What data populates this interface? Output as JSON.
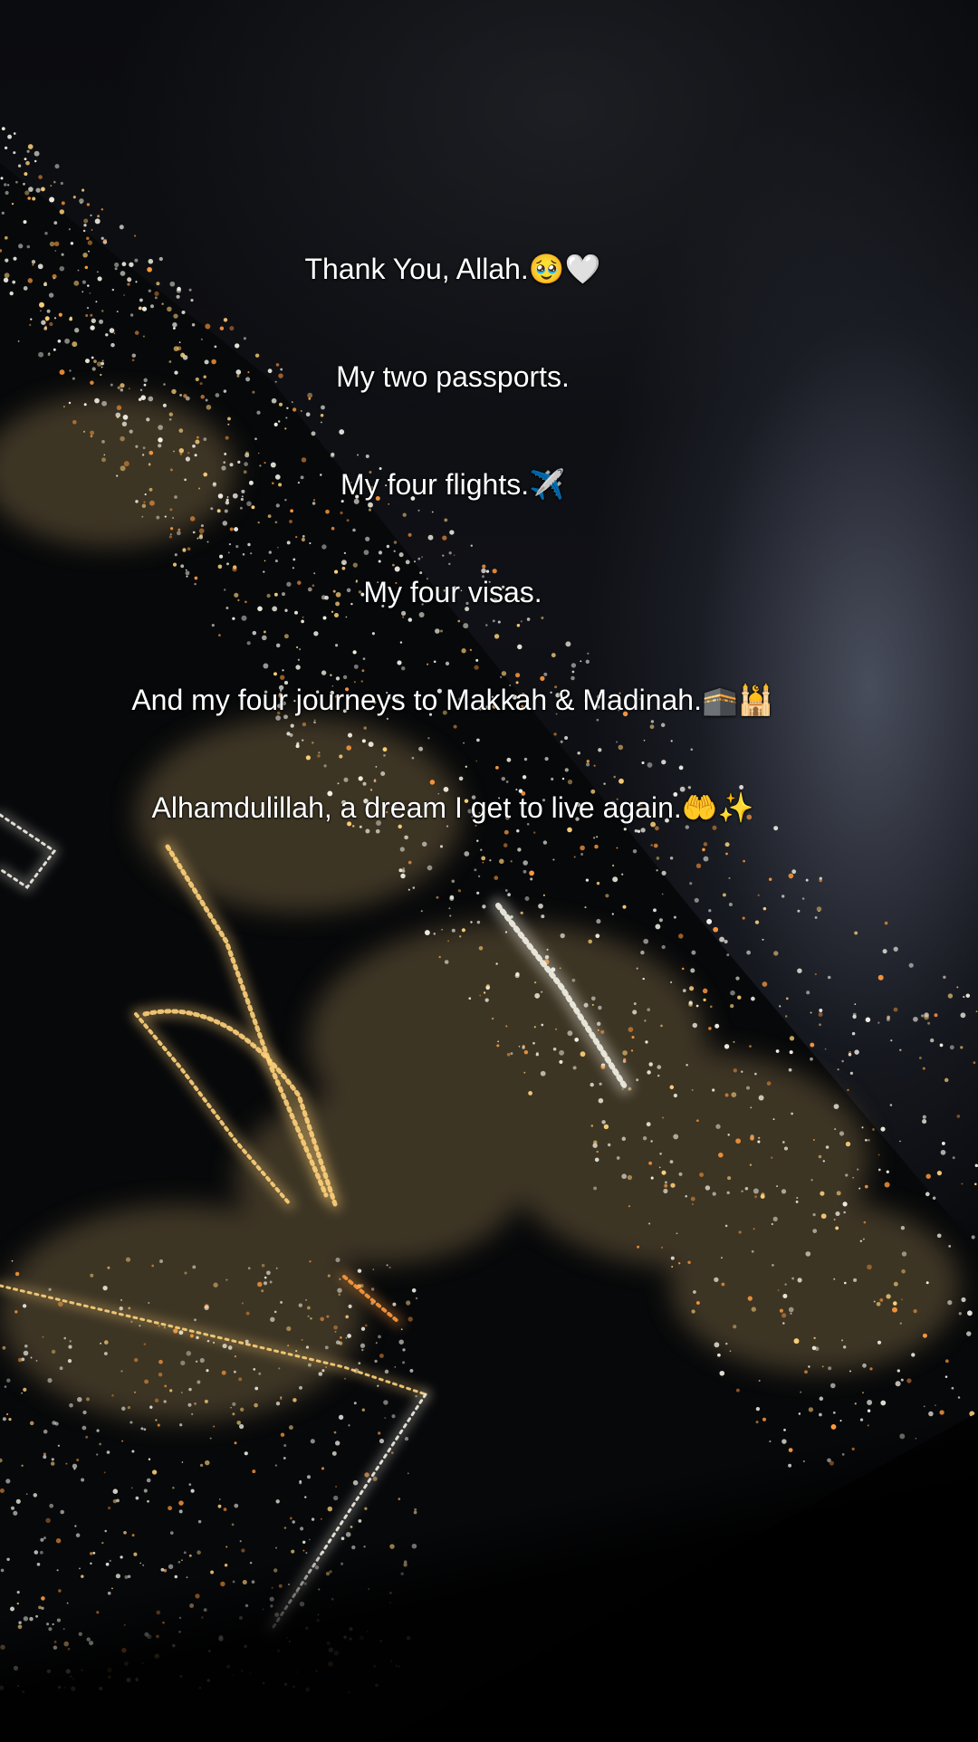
{
  "caption": {
    "line1": {
      "text": "Thank You, Allah.",
      "emoji": "🥹🤍"
    },
    "line2": {
      "text": "My two passports.",
      "emoji": ""
    },
    "line3": {
      "text": "My four flights.",
      "emoji": "✈️"
    },
    "line4": {
      "text": "My four visas.",
      "emoji": ""
    },
    "line5": {
      "text": "And my four journeys to Makkah & Madinah.",
      "emoji": "🕋🕌"
    },
    "line6": {
      "text": "Alhamdulillah, a dream I get to live again.",
      "emoji": "🤲✨"
    }
  },
  "colors": {
    "caption_text": "#ffffff",
    "night_sky": "#0b0c0f",
    "city_light_warm": "#ffd27a",
    "city_light_white": "#f4f1e6",
    "city_light_orange": "#ff9a3c"
  }
}
